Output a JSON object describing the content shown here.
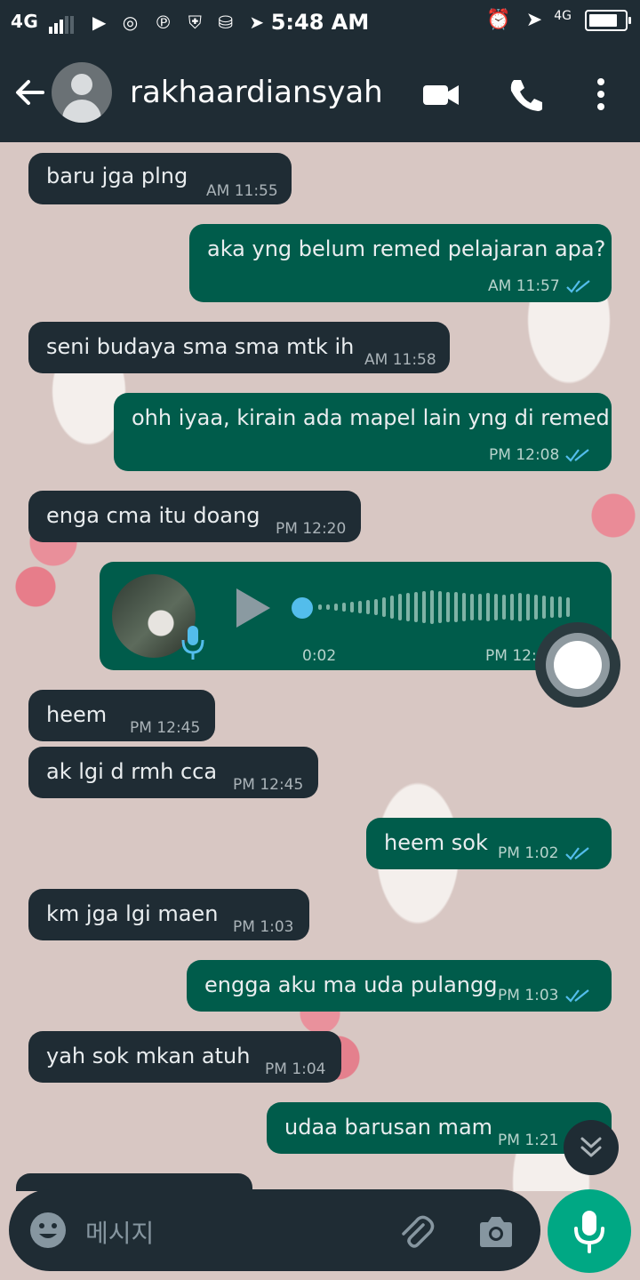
{
  "status_bar": {
    "network": "4G",
    "app_icons": "▶ ◎ ℗ ⛨ ⛁ ➤",
    "time": "5:48 AM",
    "right_network": "4G",
    "battery_level": 0.9
  },
  "header": {
    "contact_name": "rakhaardiansyah"
  },
  "messages": [
    {
      "dir": "in",
      "text": "baru jga plng",
      "time": "AM 11:55"
    },
    {
      "dir": "out",
      "text": "aka yng belum remed pelajaran apa?",
      "time": "AM 11:57"
    },
    {
      "dir": "in",
      "text": "seni budaya sma sma mtk ih",
      "time": "AM 11:58"
    },
    {
      "dir": "out",
      "text": "ohh iyaa, kirain ada mapel lain yng di remed",
      "time": "PM 12:08"
    },
    {
      "dir": "in",
      "text": "enga cma itu doang",
      "time": "PM 12:20"
    },
    {
      "dir": "in",
      "text": "heem",
      "time": "PM 12:45"
    },
    {
      "dir": "in",
      "text": "ak lgi d rmh cca",
      "time": "PM 12:45"
    },
    {
      "dir": "out",
      "text": "heem sok",
      "time": "PM 1:02"
    },
    {
      "dir": "in",
      "text": "km jga lgi maen",
      "time": "PM 1:03"
    },
    {
      "dir": "out",
      "text": "engga aku ma uda pulangg",
      "time": "PM 1:03"
    },
    {
      "dir": "in",
      "text": "yah sok mkan atuh",
      "time": "PM 1:04"
    },
    {
      "dir": "out",
      "text": "udaa barusan mam",
      "time": "PM 1:21"
    }
  ],
  "voice_note": {
    "duration": "0:02",
    "time": "PM 12:",
    "progress": 0
  },
  "composer": {
    "placeholder": "메시지"
  },
  "colors": {
    "app_bar": "#1f2c34",
    "incoming_bubble": "#1f2c34",
    "outgoing_bubble": "#005c4b",
    "read_ticks": "#53bdeb",
    "mic_button": "#00a884"
  },
  "icons": [
    "back-arrow-icon",
    "avatar-icon",
    "video-call-icon",
    "phone-icon",
    "more-vert-icon",
    "play-icon",
    "mic-icon",
    "double-check-icon",
    "chevron-double-down-icon",
    "emoji-icon",
    "attach-icon",
    "camera-icon",
    "record-icon"
  ]
}
